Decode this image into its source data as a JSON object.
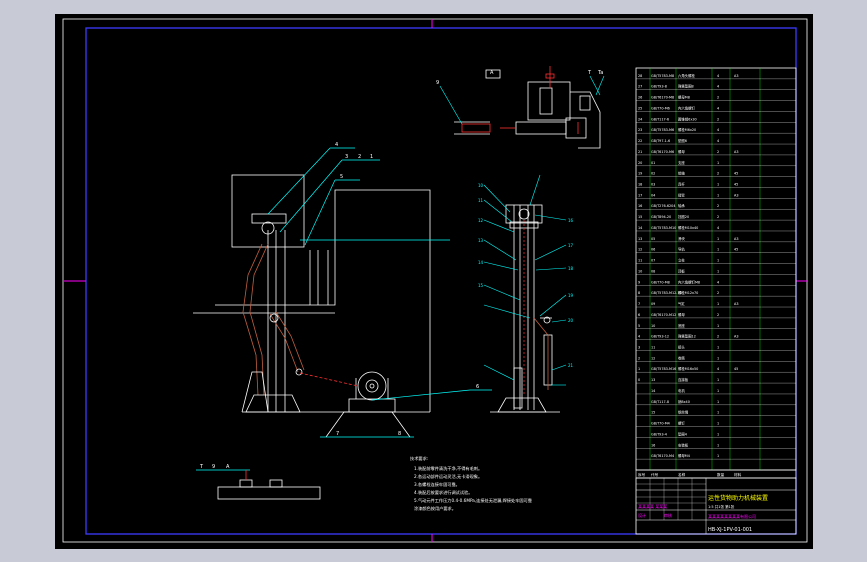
{
  "drawing": {
    "title_block": {
      "title": "运性货物助力机械装置",
      "drawing_number": "HB-XJ-1PV-01-001",
      "maker_line": "某某某某 某某某",
      "designer_label": "设计",
      "checker_label": "审核",
      "company": "某某某某某某某某有限公司",
      "scale_info": "1:5  共1张  第1张"
    },
    "bom_header": {
      "no": "序号",
      "code": "代号",
      "name": "名称",
      "qty": "数量",
      "material": "材料"
    },
    "bom_rows": [
      {
        "no": "28",
        "code": "GB/T5783-M8",
        "name": "六角头螺栓",
        "qty": "4",
        "material": "A3"
      },
      {
        "no": "27",
        "code": "GB/T93-8",
        "name": "弹簧垫圈8",
        "qty": "4",
        "material": ""
      },
      {
        "no": "26",
        "code": "GB/T6170-M8",
        "name": "螺母M8",
        "qty": "2",
        "material": ""
      },
      {
        "no": "25",
        "code": "GB/T70-M6",
        "name": "内六角螺钉",
        "qty": "4",
        "material": ""
      },
      {
        "no": "24",
        "code": "GB/T117-6",
        "name": "圆锥销6x30",
        "qty": "2",
        "material": ""
      },
      {
        "no": "23",
        "code": "GB/T5783-M6",
        "name": "螺栓M6x20",
        "qty": "4",
        "material": ""
      },
      {
        "no": "22",
        "code": "GB/T97.1-6",
        "name": "垫圈6",
        "qty": "4",
        "material": ""
      },
      {
        "no": "21",
        "code": "GB/T6170-M6",
        "name": "螺母",
        "qty": "2",
        "material": "A3"
      },
      {
        "no": "20",
        "code": "01",
        "name": "支座",
        "qty": "1",
        "material": ""
      },
      {
        "no": "19",
        "code": "02",
        "name": "销轴",
        "qty": "2",
        "material": "45"
      },
      {
        "no": "18",
        "code": "03",
        "name": "连杆",
        "qty": "1",
        "material": "45"
      },
      {
        "no": "17",
        "code": "04",
        "name": "摇臂",
        "qty": "1",
        "material": "A3"
      },
      {
        "no": "16",
        "code": "GB/T276-6204",
        "name": "轴承",
        "qty": "2",
        "material": ""
      },
      {
        "no": "15",
        "code": "GB/T894-20",
        "name": "挡圈20",
        "qty": "2",
        "material": ""
      },
      {
        "no": "14",
        "code": "GB/T5783-M10",
        "name": "螺栓M10x40",
        "qty": "4",
        "material": ""
      },
      {
        "no": "13",
        "code": "05",
        "name": "滑块",
        "qty": "1",
        "material": "A3"
      },
      {
        "no": "12",
        "code": "06",
        "name": "导轨",
        "qty": "1",
        "material": "45"
      },
      {
        "no": "11",
        "code": "07",
        "name": "立柱",
        "qty": "1",
        "material": ""
      },
      {
        "no": "10",
        "code": "08",
        "name": "顶板",
        "qty": "1",
        "material": ""
      },
      {
        "no": "9",
        "code": "GB/T70-M8",
        "name": "内六角螺钉M8",
        "qty": "4",
        "material": ""
      },
      {
        "no": "8",
        "code": "GB/T5783-M12-70",
        "name": "螺栓M12x70",
        "qty": "2",
        "material": ""
      },
      {
        "no": "7",
        "code": "09",
        "name": "气缸",
        "qty": "1",
        "material": "A3"
      },
      {
        "no": "6",
        "code": "GB/T6170-M12",
        "name": "螺母",
        "qty": "2",
        "material": ""
      },
      {
        "no": "5",
        "code": "10",
        "name": "底座",
        "qty": "1",
        "material": ""
      },
      {
        "no": "4",
        "code": "GB/T93-12",
        "name": "弹簧垫圈12",
        "qty": "2",
        "material": "A3"
      },
      {
        "no": "3",
        "code": "11",
        "name": "接头",
        "qty": "1",
        "material": ""
      },
      {
        "no": "2",
        "code": "12",
        "name": "卷筒",
        "qty": "1",
        "material": ""
      },
      {
        "no": "1",
        "code": "GB/T5783-M16",
        "name": "螺栓M16x50",
        "qty": "4",
        "material": "45"
      },
      {
        "no": "0",
        "code": "13",
        "name": "连接板",
        "qty": "1",
        "material": ""
      },
      {
        "no": "",
        "code": "14",
        "name": "电机",
        "qty": "1",
        "material": ""
      },
      {
        "no": "",
        "code": "GB/T117-8",
        "name": "销8x40",
        "qty": "1",
        "material": ""
      },
      {
        "no": "",
        "code": "15",
        "name": "钢丝绳",
        "qty": "1",
        "material": ""
      },
      {
        "no": "",
        "code": "GB/T70-M4",
        "name": "螺钉",
        "qty": "1",
        "material": ""
      },
      {
        "no": "",
        "code": "GB/T93-4",
        "name": "垫圈4",
        "qty": "1",
        "material": ""
      },
      {
        "no": "",
        "code": "16",
        "name": "安装板",
        "qty": "1",
        "material": ""
      },
      {
        "no": "",
        "code": "GB/T6170-M4",
        "name": "螺母M4",
        "qty": "1",
        "material": ""
      }
    ],
    "tech_requirements": {
      "heading": "技术要求:",
      "lines": [
        "1.装配前零件清洗干净,不得有毛刺。",
        "2.各运动部件运动灵活,无卡滞现象。",
        "3.各螺栓连接牢固可靠。",
        "4.装配后按要求进行调试试验。",
        "5.气动元件工作压力0.4-0.6MPa,连接处无泄漏,焊接处牢固可靠",
        "涂漆颜色按用户要求。"
      ]
    },
    "leader_labels": {
      "left_view": [
        "4",
        "3",
        "2",
        "1",
        "5",
        "6",
        "7",
        "8"
      ],
      "right_view": [
        "10",
        "11",
        "12",
        "13",
        "14",
        "15",
        "16",
        "17",
        "18",
        "19",
        "20",
        "21"
      ],
      "top_detail": [
        "T",
        "Ta",
        "9",
        "A"
      ],
      "bottom_detail": [
        "T",
        "9",
        "A"
      ]
    },
    "colors": {
      "sheet_bg": "#000000",
      "frame_border": "#3a3aff",
      "outer_frame": "#ffffff",
      "cad_white": "#ffffff",
      "cad_cyan": "#00ffff",
      "cad_red": "#ff3030",
      "cad_magenta": "#ff00ff",
      "cad_yellow": "#ffff00",
      "cad_green": "#00ff00",
      "outer_bg": "#c8cbd6"
    }
  }
}
